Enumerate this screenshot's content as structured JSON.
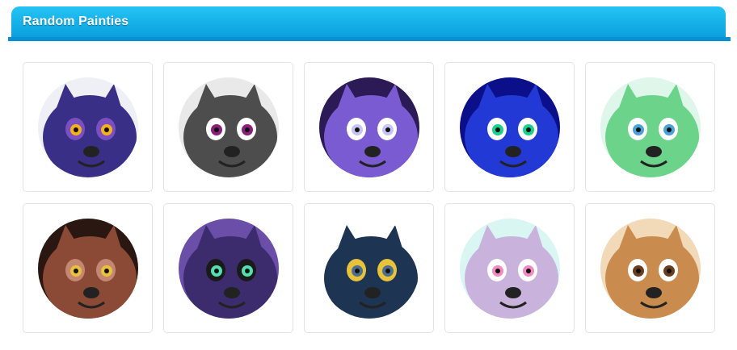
{
  "header": {
    "title": "Random Painties",
    "accent": "#1bb4ec"
  },
  "painties": [
    {
      "name": "dragon-purple-icon",
      "palette": [
        "#eef0f6",
        "#3a2f86",
        "#f5b11c",
        "#7a4fc0"
      ]
    },
    {
      "name": "dog-grey-flower-icon",
      "palette": [
        "#e9e9e9",
        "#4d4d4d",
        "#8a1f7a",
        "#ffffff"
      ]
    },
    {
      "name": "creature-grin-purple-icon",
      "palette": [
        "#2b1a55",
        "#7a5bd1",
        "#c9c2f5",
        "#ffffff"
      ]
    },
    {
      "name": "cat-blue-icon",
      "palette": [
        "#0b0f8a",
        "#2239d6",
        "#19d18c",
        "#ffffff"
      ]
    },
    {
      "name": "canine-green-hair-icon",
      "palette": [
        "#dff6ea",
        "#6cd38a",
        "#4aa2d6",
        "#ffffff"
      ]
    },
    {
      "name": "otter-brown-icon",
      "palette": [
        "#2b1712",
        "#8a4a35",
        "#e8c23a",
        "#c48773"
      ]
    },
    {
      "name": "creature-glasses-purple-icon",
      "palette": [
        "#6a4ea8",
        "#3c2c6e",
        "#53e0b0",
        "#1a1a1a"
      ]
    },
    {
      "name": "demon-navy-icon",
      "palette": [
        "#ffffff",
        "#1d3552",
        "#4d6f8f",
        "#e8c23a"
      ]
    },
    {
      "name": "canine-mint-icon",
      "palette": [
        "#d9f6f2",
        "#c9b3dd",
        "#f08ac0",
        "#ffffff"
      ]
    },
    {
      "name": "hyena-tan-icon",
      "palette": [
        "#f2d9b8",
        "#c98c4e",
        "#6b3d1f",
        "#ffffff"
      ]
    }
  ]
}
